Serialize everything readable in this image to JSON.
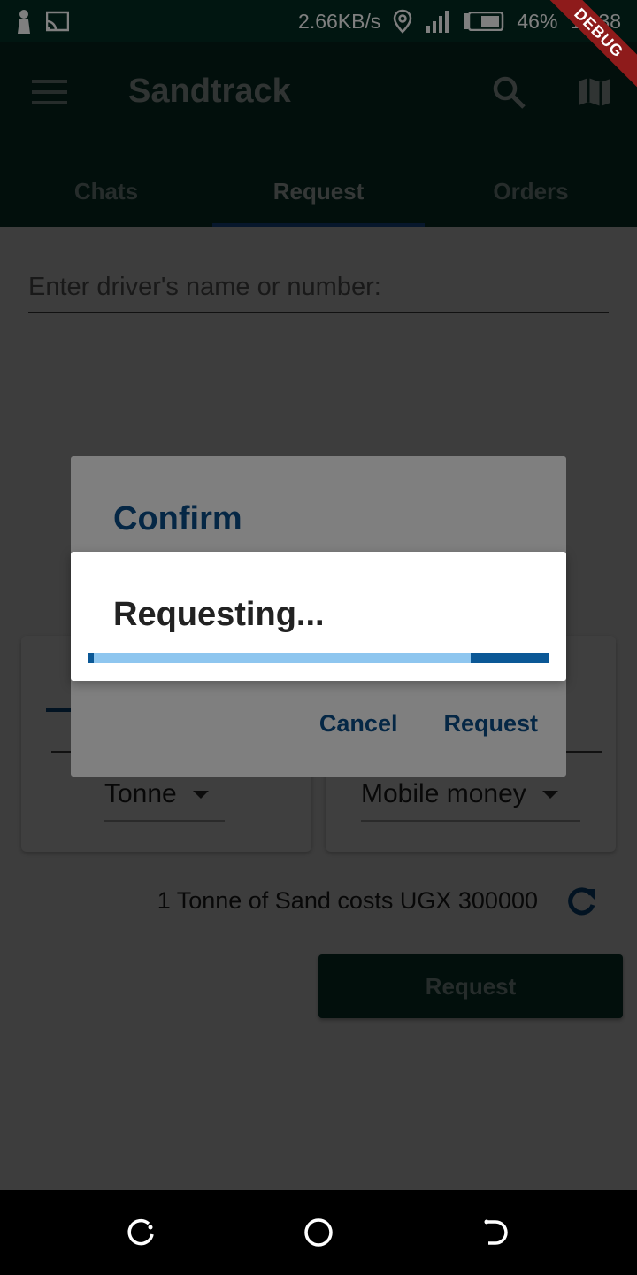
{
  "status_bar": {
    "network_speed": "2.66KB/s",
    "battery": "46%",
    "time": "18:38",
    "debug_label": "DEBUG",
    "icons": [
      "person-icon",
      "cast-icon",
      "location-icon",
      "signal-icon",
      "battery-icon"
    ]
  },
  "app_bar": {
    "title": "Sandtrack",
    "menu_icon": "menu-icon",
    "search_icon": "search-icon",
    "map_icon": "map-icon",
    "tabs": [
      {
        "label": "Chats"
      },
      {
        "label": "Request",
        "active": true
      },
      {
        "label": "Orders"
      }
    ]
  },
  "form": {
    "driver_placeholder": "Enter driver's name or number:",
    "unit_select": "Tonne",
    "payment_select": "Mobile money",
    "price_text": "1 Tonne of Sand costs UGX 300000",
    "request_button": "Request"
  },
  "confirm_dialog": {
    "title": "Confirm",
    "cancel": "Cancel",
    "request": "Request"
  },
  "progress_dialog": {
    "label": "Requesting...",
    "progress": 0.83
  },
  "colors": {
    "primary": "#083c33",
    "accent": "#0b4f8a",
    "progress_light": "#8ec6ef",
    "progress_dark": "#0b5896"
  },
  "nav_bar": {
    "icons": [
      "recent-apps-icon",
      "home-icon",
      "back-icon"
    ]
  }
}
